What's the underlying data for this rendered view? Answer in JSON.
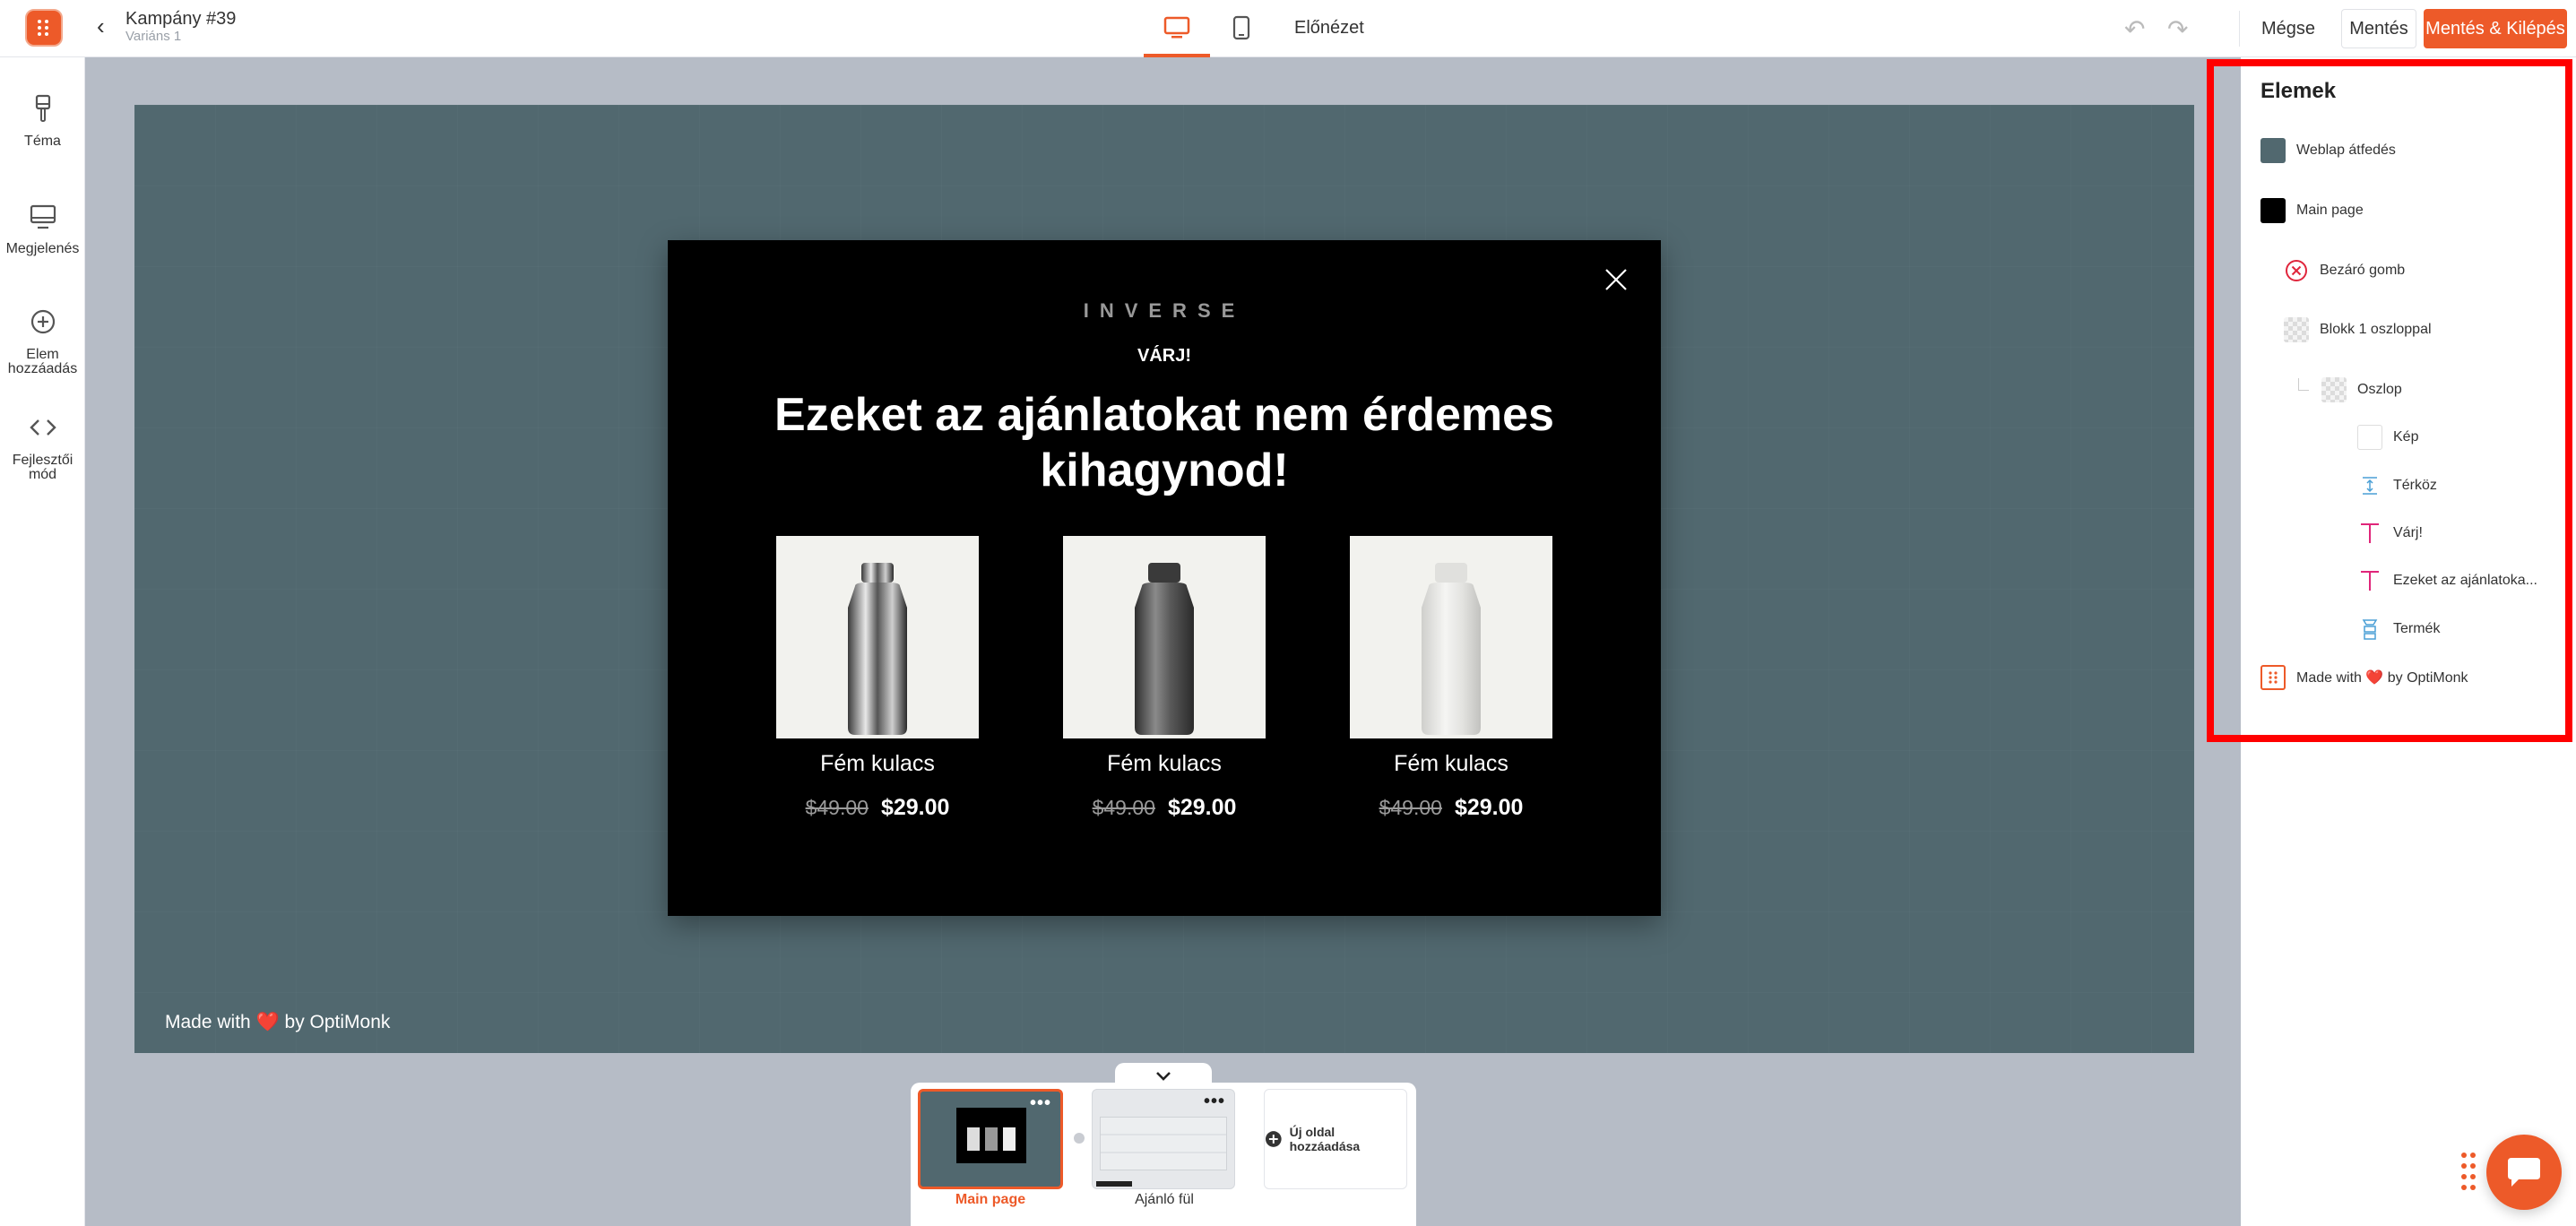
{
  "header": {
    "campaign_title": "Kampány #39",
    "variant": "Variáns 1",
    "preview": "Előnézet",
    "cancel": "Mégse",
    "save": "Mentés",
    "save_exit": "Mentés & Kilépés"
  },
  "sidebar": {
    "items": [
      {
        "label": "Téma",
        "icon": "brush-icon"
      },
      {
        "label": "Megjelenés",
        "icon": "monitor-icon"
      },
      {
        "label": "Elem hozzáadás",
        "icon": "plus-circle-icon"
      },
      {
        "label": "Fejlesztői mód",
        "icon": "code-icon"
      }
    ]
  },
  "canvas": {
    "footer": "Made with ❤️ by OptiMonk",
    "background_color": "#51686f"
  },
  "popup": {
    "brand": "INVERSE",
    "wait": "VÁRJ!",
    "headline": "Ezeket az ajánlatokat nem érdemes kihagynod!",
    "products": [
      {
        "name": "Fém kulacs",
        "old_price": "$49.00",
        "price": "$29.00",
        "bottle": "silver"
      },
      {
        "name": "Fém kulacs",
        "old_price": "$49.00",
        "price": "$29.00",
        "bottle": "dark"
      },
      {
        "name": "Fém kulacs",
        "old_price": "$49.00",
        "price": "$29.00",
        "bottle": "white"
      }
    ]
  },
  "panel": {
    "title": "Elemek",
    "layers": [
      {
        "label": "Weblap átfedés",
        "icon": "overlay-swatch"
      },
      {
        "label": "Main page",
        "icon": "page-swatch"
      },
      {
        "label": "Bezáró gomb",
        "icon": "close-circle-icon"
      },
      {
        "label": "Blokk 1 oszloppal",
        "icon": "block-icon"
      },
      {
        "label": "Oszlop",
        "icon": "column-icon"
      },
      {
        "label": "Kép",
        "icon": "image-icon"
      },
      {
        "label": "Térköz",
        "icon": "spacer-icon"
      },
      {
        "label": "Várj!",
        "icon": "text-icon"
      },
      {
        "label": "Ezeket az ajánlatoka...",
        "icon": "text-icon"
      },
      {
        "label": "Termék",
        "icon": "product-icon"
      },
      {
        "label": "Made with ❤️ by OptiMonk",
        "icon": "optimonk-icon"
      }
    ]
  },
  "pages": {
    "items": [
      {
        "label": "Main page",
        "active": true
      },
      {
        "label": "Ajánló fül",
        "active": false
      }
    ],
    "add_page": "Új oldal hozzáadása"
  },
  "colors": {
    "accent": "#ed5a29",
    "highlight": "#ff0000",
    "popup_bg": "#000000"
  }
}
